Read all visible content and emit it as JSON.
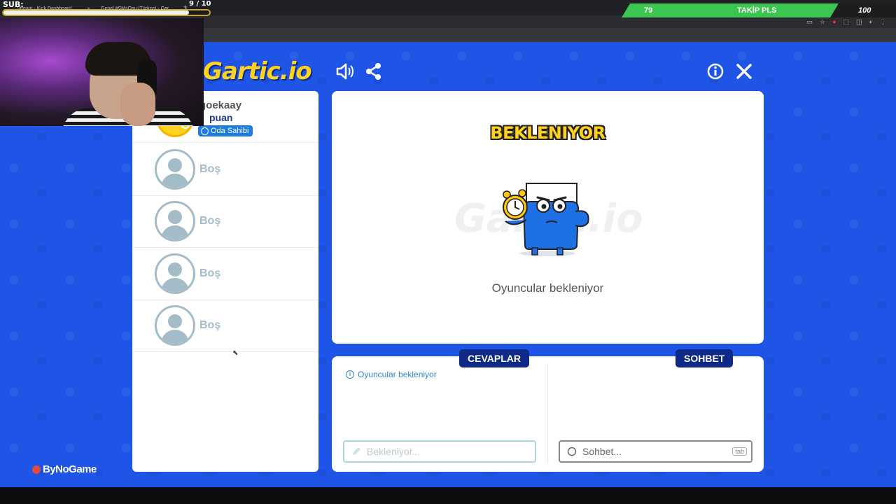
{
  "browser": {
    "tabs": [
      {
        "label": "Stream - Kick Dashboard"
      },
      {
        "label": "Genel #SMsOsu (Türkçe) - Gar"
      }
    ],
    "new_tab": "+"
  },
  "overlay": {
    "sub_label": "SUB:",
    "sub_count": "9 / 10",
    "sub_progress": 0.9,
    "follow_current": "79",
    "follow_label": "TAKİP PLS",
    "follow_target": "100",
    "goal_color": "#3cc650",
    "sponsor": "ByNoGame"
  },
  "game": {
    "logo": "Gartic.io",
    "icons": {
      "sound": "speaker-icon",
      "share": "share-icon",
      "info": "info-icon",
      "close": "close-icon"
    },
    "owner": {
      "name": "goekaay",
      "points": "puan",
      "badge": "Oda Sahibi"
    },
    "slots": [
      "Boş",
      "Boş",
      "Boş",
      "Boş"
    ],
    "status_title": "BEKLENIYOR",
    "watermark": "Gartic.io",
    "status_text": "Oyuncular bekleniyor",
    "answers_label": "CEVAPLAR",
    "chat_label": "SOHBET",
    "answers_info": "Oyuncular bekleniyor",
    "answer_placeholder": "Bekleniyor...",
    "chat_placeholder": "Sohbet...",
    "tab_hint": "tab",
    "brand_color": "#1e55e6",
    "accent_color": "#ffd21f",
    "pill_color": "#0f2a86"
  }
}
